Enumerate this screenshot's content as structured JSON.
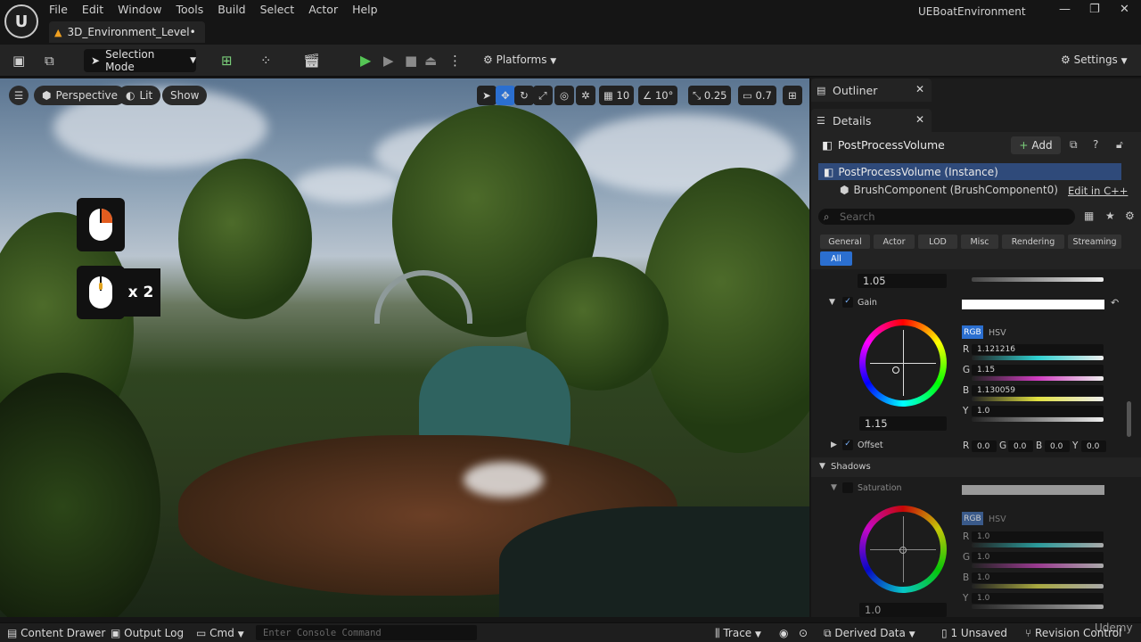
{
  "app": {
    "logo": "unreal-logo",
    "project": "UEBoatEnvironment",
    "level_tab": "3D_Environment_Level•"
  },
  "menu": [
    "File",
    "Edit",
    "Window",
    "Tools",
    "Build",
    "Select",
    "Actor",
    "Help"
  ],
  "toolbar": {
    "selection_mode": "Selection Mode",
    "platforms": "Platforms",
    "settings": "Settings"
  },
  "viewport": {
    "perspective": "Perspective",
    "lit": "Lit",
    "show": "Show",
    "grid_snap": "10",
    "rot_snap": "10°",
    "scale_snap": "0.25",
    "cam_speed": "0.7",
    "overlay_multiplier": "x 2"
  },
  "outliner": {
    "tab": "Outliner"
  },
  "details": {
    "tab": "Details",
    "actor": "PostProcessVolume",
    "add": "Add",
    "instance": "PostProcessVolume (Instance)",
    "component": "BrushComponent (BrushComponent0)",
    "edit_cpp": "Edit in C++",
    "search_placeholder": "Search",
    "filters": [
      "General",
      "Actor",
      "LOD",
      "Misc",
      "Rendering",
      "Streaming",
      "All"
    ],
    "top_value": "1.05",
    "gain": {
      "label": "Gain",
      "rgb": "RGB",
      "hsv": "HSV",
      "r": "1.121216",
      "g": "1.15",
      "b": "1.130059",
      "y": "1.0",
      "value": "1.15"
    },
    "offset": {
      "label": "Offset",
      "r": "0.0",
      "g": "0.0",
      "b": "0.0",
      "y": "0.0"
    },
    "shadows": "Shadows",
    "saturation": {
      "label": "Saturation",
      "rgb": "RGB",
      "hsv": "HSV",
      "r": "1.0",
      "g": "1.0",
      "b": "1.0",
      "y": "1.0",
      "value": "1.0"
    }
  },
  "bottom": {
    "content_drawer": "Content Drawer",
    "output_log": "Output Log",
    "cmd": "Cmd",
    "console_placeholder": "Enter Console Command",
    "trace": "Trace",
    "derived_data": "Derived Data",
    "unsaved": "1 Unsaved",
    "revision": "Revision Control"
  },
  "watermark": "Udemy"
}
